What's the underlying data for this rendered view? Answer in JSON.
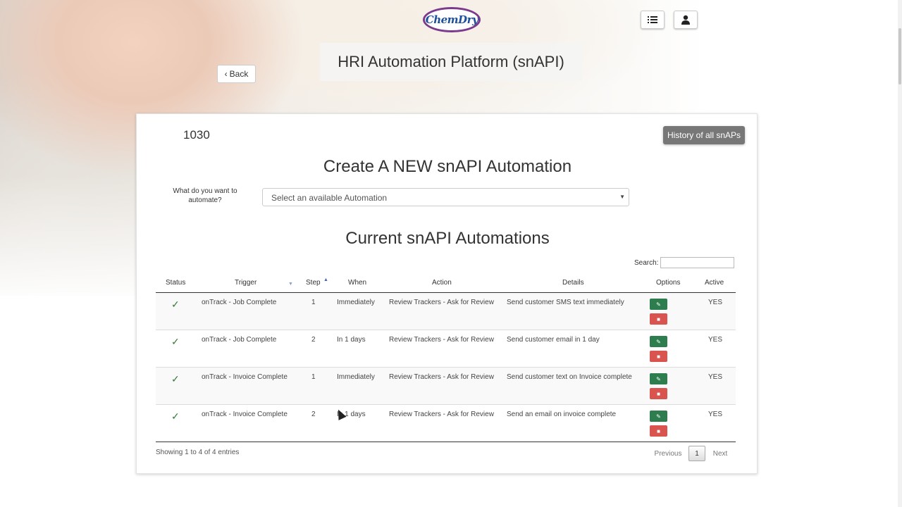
{
  "header": {
    "logo_text": "ChemDry",
    "menu_icon": "list-icon",
    "user_icon": "user-icon",
    "back_label": "Back",
    "title": "HRI Automation Platform (snAPI)"
  },
  "card": {
    "code": "1030",
    "history_label": "History of all snAPs",
    "create_title": "Create A NEW snAPI Automation",
    "automate_label": "What do you want to automate?",
    "select_placeholder": "Select an available Automation",
    "current_title": "Current snAPI Automations",
    "search_label": "Search:"
  },
  "table": {
    "columns": [
      "Status",
      "Trigger",
      "Step",
      "When",
      "Action",
      "Details",
      "Options",
      "Active"
    ],
    "rows": [
      {
        "status": "✓",
        "trigger": "onTrack - Job Complete",
        "step": "1",
        "when": "Immediately",
        "action": "Review Trackers - Ask for Review",
        "details": "Send customer SMS text immediately",
        "active": "YES"
      },
      {
        "status": "✓",
        "trigger": "onTrack - Job Complete",
        "step": "2",
        "when": "In 1 days",
        "action": "Review Trackers - Ask for Review",
        "details": "Send customer email in 1 day",
        "active": "YES"
      },
      {
        "status": "✓",
        "trigger": "onTrack - Invoice Complete",
        "step": "1",
        "when": "Immediately",
        "action": "Review Trackers - Ask for Review",
        "details": "Send customer text on Invoice complete",
        "active": "YES"
      },
      {
        "status": "✓",
        "trigger": "onTrack - Invoice Complete",
        "step": "2",
        "when": "In 1 days",
        "action": "Review Trackers - Ask for Review",
        "details": "Send an email on invoice complete",
        "active": "YES"
      }
    ]
  },
  "footer": {
    "info": "Showing 1 to 4 of 4 entries",
    "previous": "Previous",
    "page": "1",
    "next": "Next"
  },
  "colors": {
    "edit_button": "#2e7d4f",
    "delete_button": "#d9534f",
    "history_button": "#777777"
  }
}
